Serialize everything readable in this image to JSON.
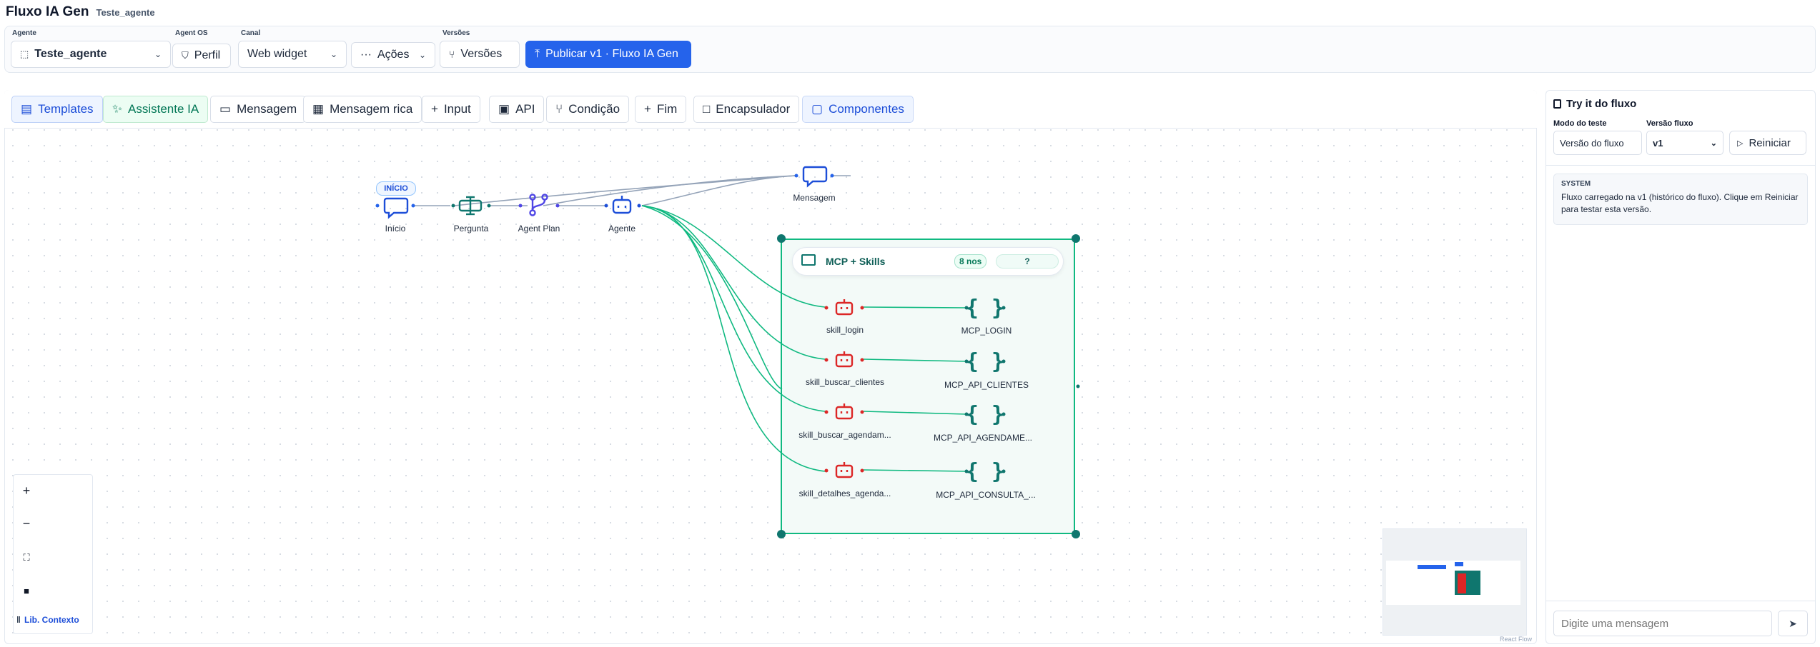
{
  "app": {
    "title": "Fluxo IA Gen",
    "subtitle": "Teste_agente"
  },
  "topbar": {
    "agent_label": "Agente",
    "agent_value": "Teste_agente",
    "agent_os_label": "Agent OS",
    "profile_button": "Perfil",
    "channel_label": "Canal",
    "channel_value": "Web widget",
    "actions_button": "Ações",
    "versions_label": "Versões",
    "versions_button": "Versões",
    "publish_button": "Publicar v1 · Fluxo IA Gen"
  },
  "toolbar": {
    "items": [
      "Templates",
      "Assistente IA",
      "Mensagem",
      "Mensagem rica",
      "Input",
      "API",
      "Condição",
      "Fim",
      "Encapsulador",
      "Componentes"
    ]
  },
  "flow": {
    "start_badge": "INÍCIO",
    "nodes": {
      "inicio": "Início",
      "pergunta": "Pergunta",
      "agent_plan": "Agent Plan",
      "agente": "Agente",
      "mensagem": "Mensagem"
    },
    "group": {
      "title": "MCP + Skills",
      "count": "8 nos",
      "help": "?",
      "skills": [
        "skill_login",
        "skill_buscar_clientes",
        "skill_buscar_agendam...",
        "skill_detalhes_agenda..."
      ],
      "mcps": [
        "MCP_LOGIN",
        "MCP_API_CLIENTES",
        "MCP_API_AGENDAME...",
        "MCP_API_CONSULTA_..."
      ]
    }
  },
  "canvas_controls": {
    "context_library": "Lib. Contexto"
  },
  "attribution": "React Flow",
  "tryit": {
    "title": "Try it do fluxo",
    "mode_label": "Modo do teste",
    "mode_value": "Versão do fluxo",
    "version_label": "Versão fluxo",
    "version_value": "v1",
    "restart_button": "Reiniciar",
    "system_label": "SYSTEM",
    "system_message": "Fluxo carregado na v1 (histórico do fluxo). Clique em Reiniciar para testar esta versão.",
    "input_placeholder": "Digite uma mensagem"
  },
  "colors": {
    "primary": "#2563eb",
    "edge": "#10b981",
    "agent_icon": "#1d4ed8",
    "skill_icon": "#dc2626",
    "mcp_icon": "#0f766e",
    "plan_icon": "#4f46e5"
  }
}
